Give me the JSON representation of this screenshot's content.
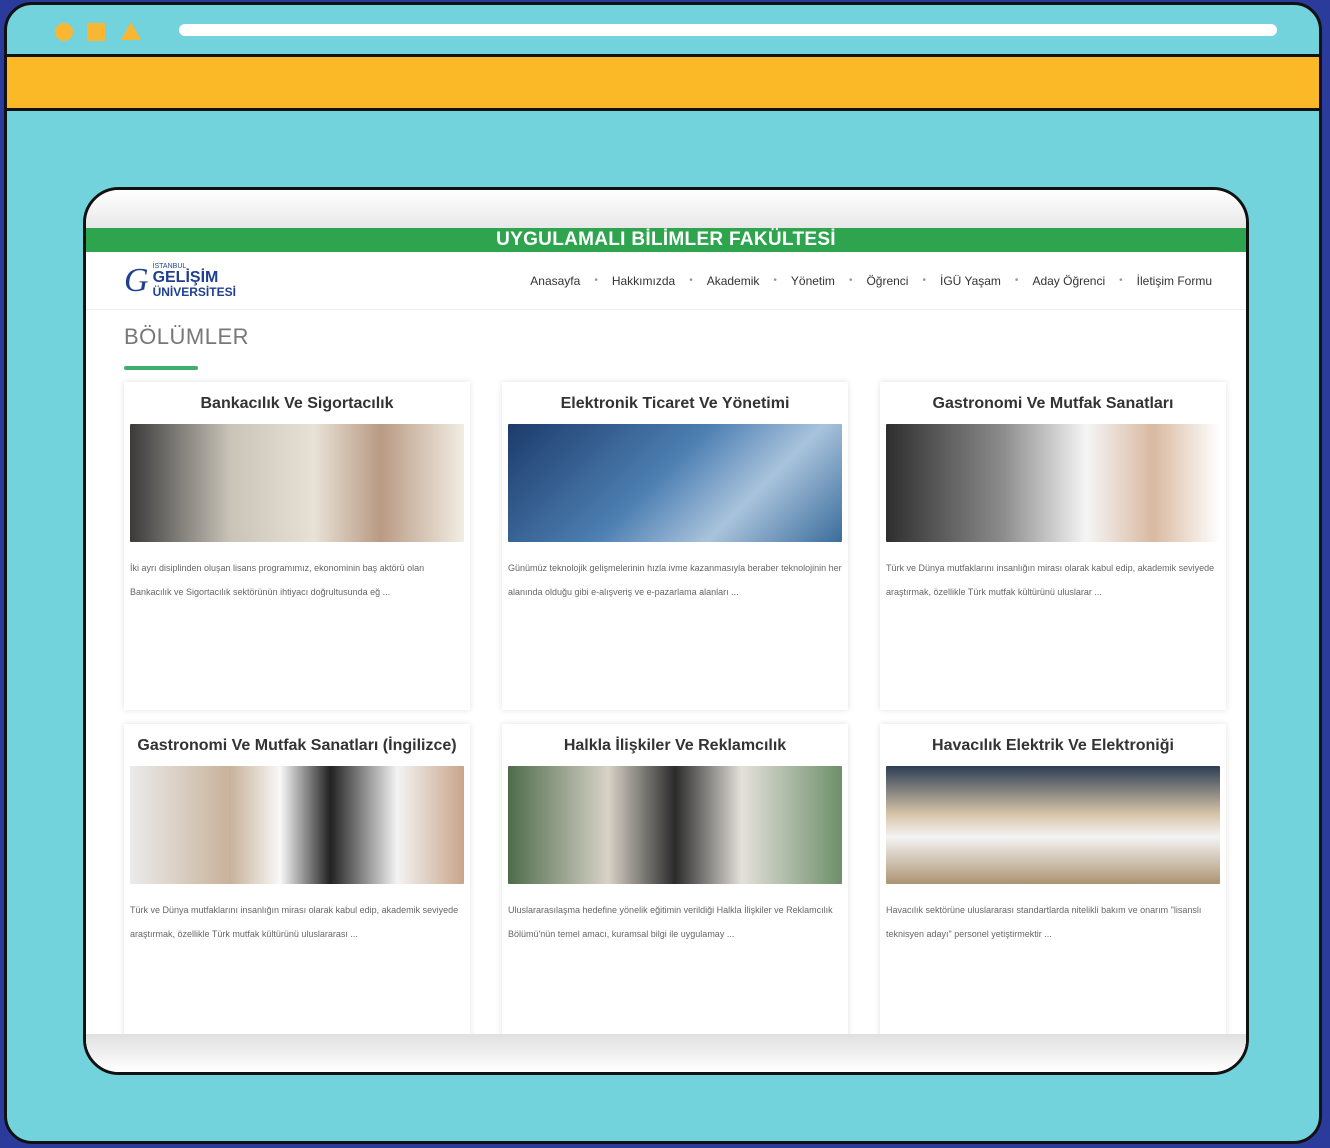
{
  "browser": {
    "controls": [
      "circle-icon",
      "square-icon",
      "triangle-icon"
    ]
  },
  "site": {
    "faculty_title": "UYGULAMALI BİLİMLER FAKÜLTESİ",
    "logo": {
      "small": "İSTANBUL",
      "big": "GELİŞİM",
      "sub": "ÜNİVERSİTESİ"
    },
    "menu": [
      "Anasayfa",
      "Hakkımızda",
      "Akademik",
      "Yönetim",
      "Öğrenci",
      "İGÜ Yaşam",
      "Aday Öğrenci",
      "İletişim Formu"
    ],
    "menu_separator": "•",
    "section_title": "BÖLÜMLER",
    "departments": [
      {
        "title": "Bankacılık Ve Sigortacılık",
        "text": "İki ayrı disiplinden oluşan lisans programımız, ekonominin baş aktörü olan Bankacılık ve Sigortacılık sektörünün ihtiyacı doğrultusunda eğ ..."
      },
      {
        "title": "Elektronik Ticaret Ve Yönetimi",
        "text": "Günümüz teknolojik gelişmelerinin hızla ivme kazanmasıyla beraber teknolojinin her alanında olduğu gibi e-alışveriş ve e-pazarlama alanları ..."
      },
      {
        "title": "Gastronomi Ve Mutfak Sanatları",
        "text": "Türk ve Dünya mutfaklarını insanlığın mirası olarak kabul edip, akademik seviyede araştırmak, özellikle Türk mutfak kültürünü uluslarar ..."
      },
      {
        "title": "Gastronomi Ve Mutfak Sanatları (İngilizce)",
        "text": "Türk ve Dünya mutfaklarını insanlığın mirası olarak kabul edip, akademik seviyede araştırmak, özellikle Türk mutfak kültürünü uluslararası ..."
      },
      {
        "title": "Halkla İlişkiler Ve Reklamcılık",
        "text": "Uluslararasılaşma hedefine yönelik eğitimin verildiği Halkla İlişkiler ve Reklamcılık Bölümü'nün temel amacı, kuramsal bilgi ile uygulamay ..."
      },
      {
        "title": "Havacılık Elektrik Ve Elektroniği",
        "text": "Havacılık sektörüne uluslararası standartlarda nitelikli bakım ve onarım \"lisanslı teknisyen adayı\" personel yetiştirmektir ..."
      }
    ]
  }
}
